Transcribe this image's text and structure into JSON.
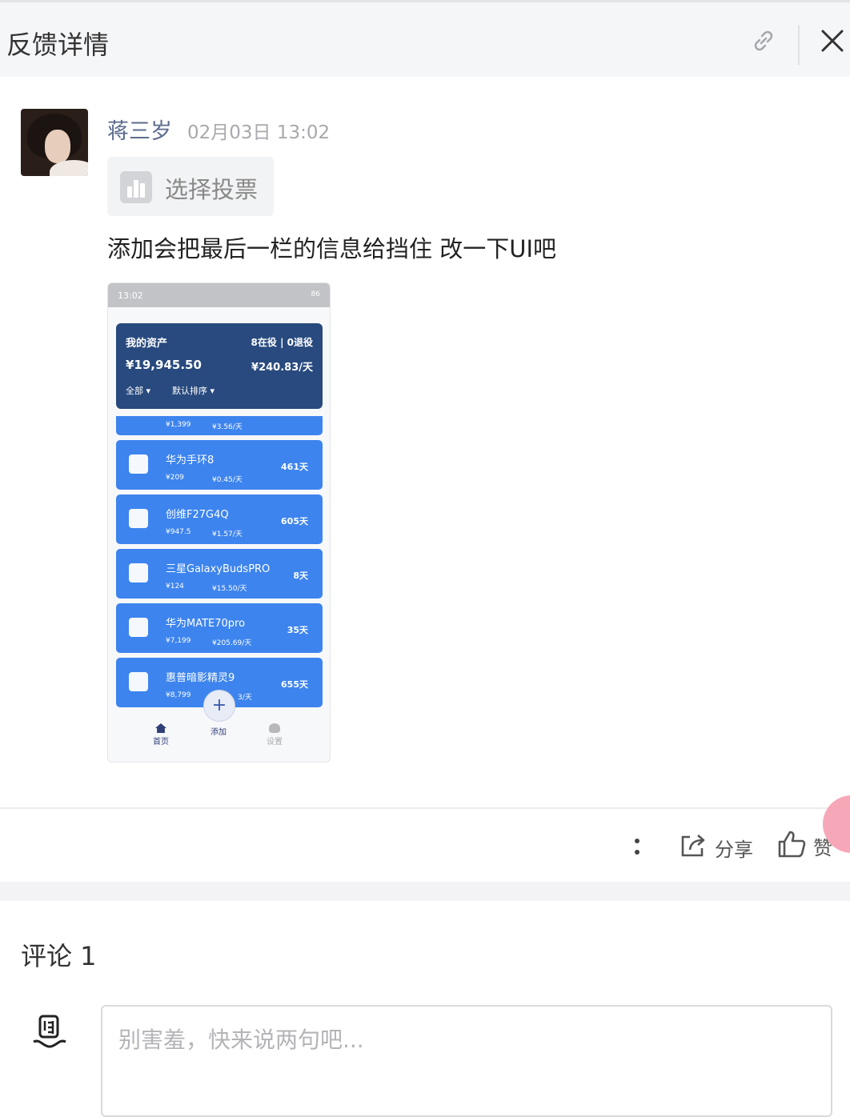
{
  "header": {
    "title": "反馈详情"
  },
  "post": {
    "username": "蒋三岁",
    "timestamp": "02月03日 13:02",
    "vote_label": "选择投票",
    "text": "添加会把最后一栏的信息给挡住 改一下UI吧"
  },
  "screenshot": {
    "status_time": "13:02",
    "status_battery": "86",
    "assets_title": "我的资产",
    "assets_total": "¥19,945.50",
    "filter_all": "全部 ▾",
    "filter_sort": "默认排序 ▾",
    "in_service": "8在役 | 0退役",
    "daily": "¥240.83/天",
    "partial_item": {
      "price": "¥1,399",
      "daily": "¥3.56/天"
    },
    "items": [
      {
        "name": "华为手环8",
        "price": "¥209",
        "daily": "¥0.45/天",
        "days": "461天"
      },
      {
        "name": "创维F27G4Q",
        "price": "¥947.5",
        "daily": "¥1.57/天",
        "days": "605天"
      },
      {
        "name": "三星GalaxyBudsPRO",
        "price": "¥124",
        "daily": "¥15.50/天",
        "days": "8天"
      },
      {
        "name": "华为MATE70pro",
        "price": "¥7,199",
        "daily": "¥205.69/天",
        "days": "35天"
      },
      {
        "name": "惠普暗影精灵9",
        "price": "¥8,799",
        "daily": "3/天",
        "days": "655天"
      }
    ],
    "fab": "+",
    "nav": {
      "home": "首页",
      "add": "添加",
      "settings": "设置"
    }
  },
  "actions": {
    "share_label": "分享",
    "like_label": "赞"
  },
  "comments": {
    "title": "评论 1",
    "placeholder": "别害羞，快来说两句吧..."
  },
  "colors": {
    "card_dark": "#284a7e",
    "card_blue": "#3d84ee",
    "accent_pink": "#f6a7b8"
  }
}
